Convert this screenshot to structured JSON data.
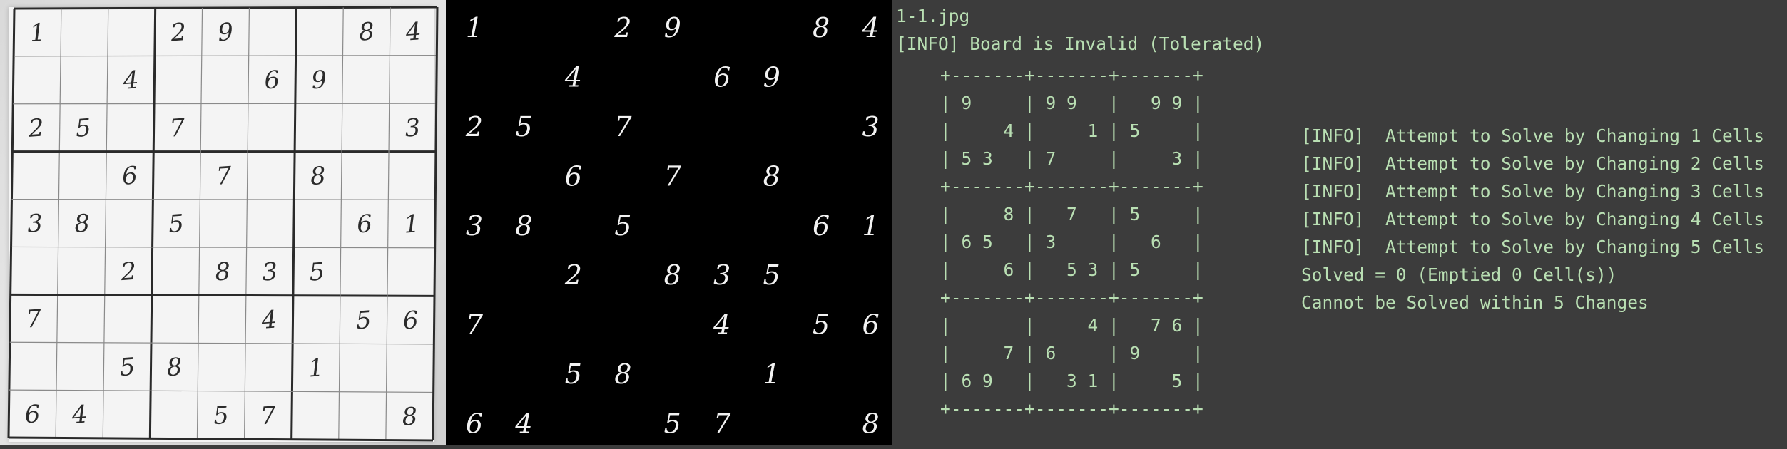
{
  "grid": [
    [
      "1",
      "",
      "",
      "2",
      "9",
      "",
      "",
      "8",
      "4"
    ],
    [
      "",
      "",
      "4",
      "",
      "",
      "6",
      "9",
      "",
      ""
    ],
    [
      "2",
      "5",
      "",
      "7",
      "",
      "",
      "",
      "",
      "3"
    ],
    [
      "",
      "",
      "6",
      "",
      "7",
      "",
      "8",
      "",
      ""
    ],
    [
      "3",
      "8",
      "",
      "5",
      "",
      "",
      "",
      "6",
      "1"
    ],
    [
      "",
      "",
      "2",
      "",
      "8",
      "3",
      "5",
      "",
      ""
    ],
    [
      "7",
      "",
      "",
      "",
      "",
      "4",
      "",
      "5",
      "6"
    ],
    [
      "",
      "",
      "5",
      "8",
      "",
      "",
      "1",
      "",
      ""
    ],
    [
      "6",
      "4",
      "",
      "",
      "5",
      "7",
      "",
      "",
      "8"
    ]
  ],
  "terminal": {
    "filename": "1-1.jpg",
    "status": "[INFO] Board is Invalid (Tolerated)",
    "board_lines": [
      "+-------+-------+-------+",
      "| 9     | 9 9   |   9 9 |",
      "|     4 |     1 | 5     |",
      "| 5 3   | 7     |     3 |",
      "+-------+-------+-------+",
      "|     8 |   7   | 5     |",
      "| 6 5   | 3     |   6   |",
      "|     6 |   5 3 | 5     |",
      "+-------+-------+-------+",
      "|       |     4 |   7 6 |",
      "|     7 | 6     | 9     |",
      "| 6 9   |   3 1 |     5 |",
      "+-------+-------+-------+"
    ],
    "attempts": [
      "[INFO]  Attempt to Solve by Changing 1 Cells",
      "[INFO]  Attempt to Solve by Changing 2 Cells",
      "[INFO]  Attempt to Solve by Changing 3 Cells",
      "[INFO]  Attempt to Solve by Changing 4 Cells",
      "[INFO]  Attempt to Solve by Changing 5 Cells"
    ],
    "solved_line": "Solved = 0 (Emptied 0 Cell(s))",
    "result_line": "Cannot be Solved within 5 Changes"
  },
  "colors": {
    "terminal_bg": "#3c3c3c",
    "terminal_text": "#b9dfb3",
    "threshold_bg": "#000000",
    "digit_white": "#f2f2f2",
    "paper": "#f4f4f4",
    "ink": "#2b2b2b"
  }
}
